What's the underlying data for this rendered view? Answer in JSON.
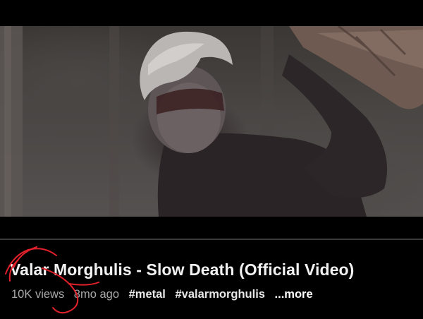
{
  "video": {
    "progress_fraction": 0.0
  },
  "title": "Valar Morghulis - Slow Death (Official Video)",
  "meta": {
    "views": "10K views",
    "age": "8mo ago",
    "hashtags": [
      "#metal",
      "#valarmorghulis"
    ],
    "more": "...more"
  },
  "colors": {
    "background": "#000000",
    "title": "#f2f2f2",
    "meta": "#a9a9a9",
    "annotation": "#e0202a"
  }
}
